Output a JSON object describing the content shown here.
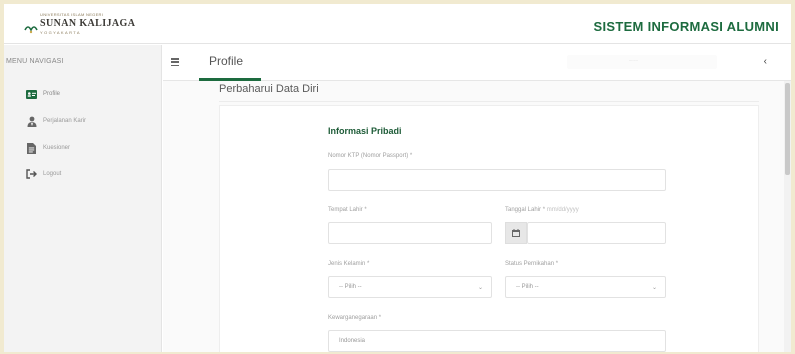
{
  "brand": {
    "logo_small": "UNIVERSITAS ISLAM NEGERI",
    "logo_main": "SUNAN KALIJAGA",
    "logo_sub": "YOGYAKARTA",
    "app_title": "SISTEM INFORMASI ALUMNI",
    "accent_color": "#1d6b3f"
  },
  "sidebar": {
    "title": "MENU NAVIGASI",
    "items": [
      {
        "label": "Profile",
        "icon": "id-card-icon",
        "active": true
      },
      {
        "label": "Perjalanan Karir",
        "icon": "user-tie-icon",
        "active": false
      },
      {
        "label": "Kuesioner",
        "icon": "document-icon",
        "active": false
      },
      {
        "label": "Logout",
        "icon": "sign-out-icon",
        "active": false
      }
    ]
  },
  "topbar": {
    "menu_icon": "hamburger-icon",
    "page_title": "Profile",
    "search_placeholder": "........",
    "collapse_icon": "chevron-left-icon"
  },
  "content": {
    "section_title": "Perbaharui Data Diri",
    "card_heading": "Informasi Pribadi",
    "fields": {
      "ktp_label": "Nomor KTP (Nomor Passport) *",
      "ktp_value": "",
      "tempat_lahir_label": "Tempat Lahir *",
      "tempat_lahir_value": "",
      "tanggal_lahir_label": "Tanggal Lahir *",
      "tanggal_lahir_hint": "mm/dd/yyyy",
      "tanggal_lahir_value": "",
      "jenis_kelamin_label": "Jenis Kelamin *",
      "jenis_kelamin_value": "-- Pilih --",
      "status_pernikahan_label": "Status Pernikahan *",
      "status_pernikahan_value": "-- Pilih --",
      "kewarganegaraan_label": "Kewarganegaraan *",
      "kewarganegaraan_value": "Indonesia"
    }
  }
}
